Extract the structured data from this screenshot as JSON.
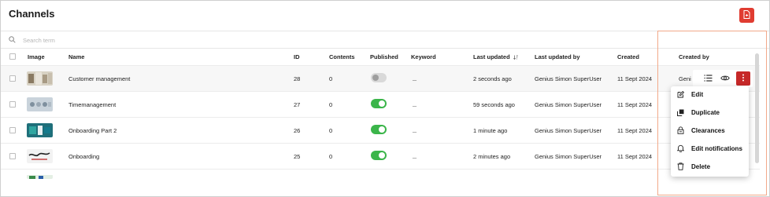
{
  "page": {
    "title": "Channels"
  },
  "search": {
    "placeholder": "Search term"
  },
  "columns": {
    "image": "Image",
    "name": "Name",
    "id": "ID",
    "contents": "Contents",
    "published": "Published",
    "keyword": "Keyword",
    "last_updated": "Last updated",
    "last_updated_by": "Last updated by",
    "created": "Created",
    "created_by": "Created by"
  },
  "rows": [
    {
      "name": "Customer management",
      "id": "28",
      "contents": "0",
      "published": false,
      "keyword": "_",
      "last_updated": "2 seconds ago",
      "last_updated_by": "Genius Simon SuperUser",
      "created": "11 Sept 2024",
      "created_by": "Geni"
    },
    {
      "name": "Timemanagement",
      "id": "27",
      "contents": "0",
      "published": true,
      "keyword": "_",
      "last_updated": "59 seconds ago",
      "last_updated_by": "Genius Simon SuperUser",
      "created": "11 Sept 2024",
      "created_by": ""
    },
    {
      "name": "Onboarding Part 2",
      "id": "26",
      "contents": "0",
      "published": true,
      "keyword": "_",
      "last_updated": "1 minute ago",
      "last_updated_by": "Genius Simon SuperUser",
      "created": "11 Sept 2024",
      "created_by": ""
    },
    {
      "name": "Onboarding",
      "id": "25",
      "contents": "0",
      "published": true,
      "keyword": "_",
      "last_updated": "2 minutes ago",
      "last_updated_by": "Genius Simon SuperUser",
      "created": "11 Sept 2024",
      "created_by": ""
    }
  ],
  "menu": {
    "edit": "Edit",
    "duplicate": "Duplicate",
    "clearances": "Clearances",
    "edit_notifications": "Edit notifications",
    "delete": "Delete"
  },
  "colors": {
    "accent": "#e03c31",
    "toggle_on": "#3bb54a",
    "more_button": "#c62828"
  }
}
